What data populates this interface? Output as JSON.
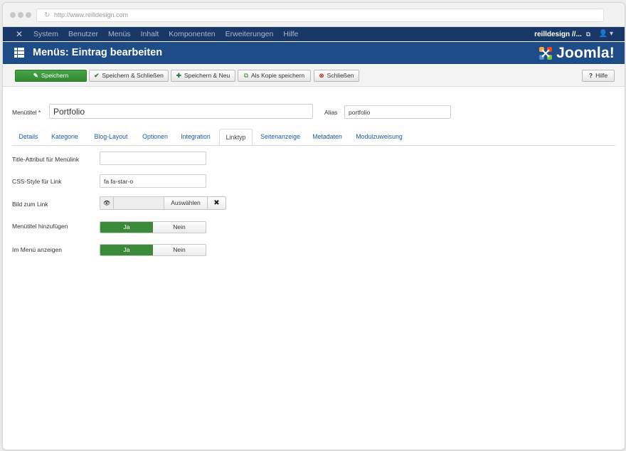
{
  "browser": {
    "url": "http://www.reilldesign.com"
  },
  "topnav": {
    "items": [
      "System",
      "Benutzer",
      "Menüs",
      "Inhalt",
      "Komponenten",
      "Erweiterungen",
      "Hilfe"
    ],
    "site_label": "reilldesign //...",
    "external_glyph": "⧉",
    "user_glyph": "👤 ▾"
  },
  "title": {
    "text": "Menüs: Eintrag bearbeiten",
    "brand": "Joomla!"
  },
  "toolbar": {
    "save": "Speichern",
    "save_close": "Speichern & Schließen",
    "save_new": "Speichern & Neu",
    "save_copy": "Als Kopie speichern",
    "close": "Schließen",
    "help": "Hilfe"
  },
  "form": {
    "title_label": "Menütitel *",
    "title_value": "Portfolio",
    "alias_label": "Alias",
    "alias_value": "portfolio"
  },
  "tabs": [
    "Details",
    "Kategorie",
    "Blog-Layout",
    "Optionen",
    "Integration",
    "Linktyp",
    "Seitenanzeige",
    "Metadaten",
    "Modulzuweisung"
  ],
  "active_tab": "Linktyp",
  "fields": {
    "title_attr_label": "Title-Attribut für Menülink",
    "title_attr_value": "",
    "css_label": "CSS-Style für Link",
    "css_value": "fa fa-star-o",
    "image_label": "Bild zum Link",
    "image_select": "Auswählen",
    "image_clear": "✖",
    "image_preview": "👁",
    "add_title_label": "Menütitel hinzufügen",
    "show_menu_label": "Im Menü anzeigen",
    "yes": "Ja",
    "no": "Nein"
  },
  "toggles": {
    "add_title": "Ja",
    "show_in_menu": "Ja"
  },
  "colors": {
    "nav": "#1a3867",
    "titlebar": "#1d4c86",
    "save_green": "#3a8a3a",
    "link_blue": "#1d5aa0"
  }
}
